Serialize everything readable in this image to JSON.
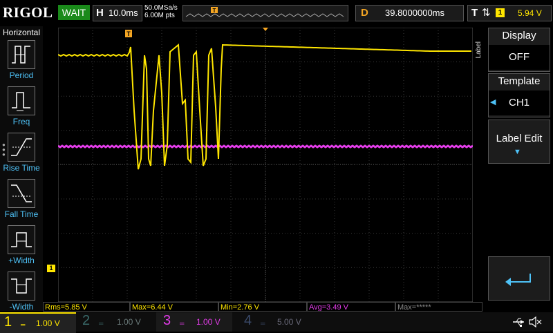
{
  "topbar": {
    "logo": "RIGOL",
    "run_state": "WAIT",
    "hscale_label": "H",
    "hscale_value": "10.0ms",
    "sample_rate": "50.0MSa/s",
    "memory_depth": "6.00M pts",
    "delay_label": "D",
    "delay_value": "39.8000000ms",
    "trigger_label": "T",
    "trigger_source": "1",
    "trigger_level": "5.94 V"
  },
  "left_panel": {
    "title": "Horizontal",
    "items": [
      {
        "label": "Period",
        "icon": "period-icon"
      },
      {
        "label": "Freq",
        "icon": "freq-icon"
      },
      {
        "label": "Rise Time",
        "icon": "rise-time-icon"
      },
      {
        "label": "Fall Time",
        "icon": "fall-time-icon"
      },
      {
        "label": "+Width",
        "icon": "pos-width-icon"
      },
      {
        "label": "-Width",
        "icon": "neg-width-icon"
      }
    ]
  },
  "right_panel": {
    "side_label": "Label",
    "display_title": "Display",
    "display_value": "OFF",
    "template_title": "Template",
    "template_value": "CH1",
    "label_edit": "Label Edit",
    "return_icon": "return-arrow-icon"
  },
  "ch1_marker": "1",
  "trigger_marker": "T",
  "measurements": [
    {
      "text": "Rms=5.85 V",
      "color": "#ffe600"
    },
    {
      "text": "Max=6.44 V",
      "color": "#ffe600"
    },
    {
      "text": "Min=2.76 V",
      "color": "#ffe600"
    },
    {
      "text": "Avg=3.49 V",
      "color": "#e23ce8"
    },
    {
      "text": "Max=*****",
      "color": "#8a8a8a"
    }
  ],
  "channels": [
    {
      "num": "1",
      "scale": "1.00 V",
      "color": "#ffe600",
      "active": true
    },
    {
      "num": "2",
      "scale": "1.00 V",
      "color": "#3a6a6a",
      "active": false
    },
    {
      "num": "3",
      "scale": "1.00 V",
      "color": "#e23ce8",
      "active": true
    },
    {
      "num": "4",
      "scale": "5.00 V",
      "color": "#3a4a6a",
      "active": false
    }
  ],
  "status_icons": [
    "usb-icon",
    "speaker-mute-icon"
  ],
  "colors": {
    "ch1": "#ffe600",
    "ch3": "#e23ce8",
    "accent": "#4ec2f7",
    "run": "#1a8a1a"
  }
}
